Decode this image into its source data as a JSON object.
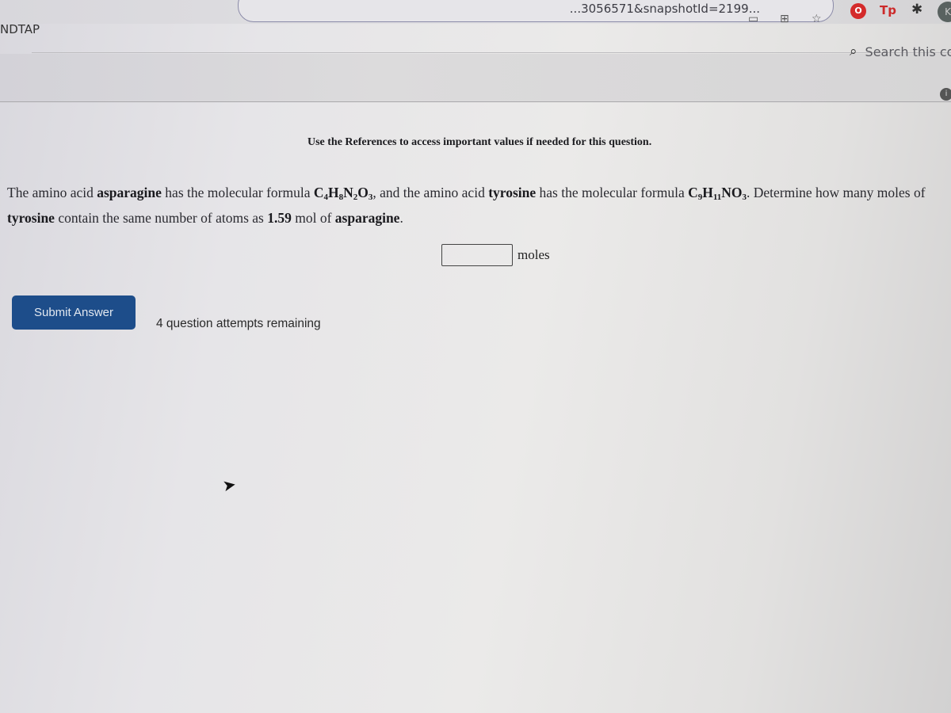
{
  "browser": {
    "url_text": "...3056571&snapshotId=2199...",
    "icons": [
      "cast-icon",
      "apps-icon",
      "bookmark-star-icon",
      "opera-extension-icon",
      "tp-extension-icon",
      "extensions-puzzle-icon",
      "profile-avatar"
    ],
    "profile_initial": "K",
    "tp_label": "Tp"
  },
  "tab": {
    "label": "NDTAP"
  },
  "header": {
    "search_placeholder": "Search this co"
  },
  "question": {
    "references_note": "Use the References to access important values if needed for this question.",
    "text_1": "The amino acid ",
    "compound_1": "asparagine",
    "text_2": " has the molecular formula ",
    "formula_1": {
      "C": "C",
      "c_sub": "4",
      "H": "H",
      "h_sub": "8",
      "N": "N",
      "n_sub": "2",
      "O": "O",
      "o_sub": "3"
    },
    "text_3": ", and the amino acid ",
    "compound_2": "tyrosine",
    "text_4": " has the molecular formula ",
    "formula_2": {
      "C": "C",
      "c_sub": "9",
      "H": "H",
      "h_sub": "11",
      "N": "NO",
      "o_sub": "3"
    },
    "text_5": ". Determine how many moles of ",
    "compound_3": "tyrosine",
    "text_6": " contain the same number of atoms as ",
    "amount": "1.59",
    "text_7": " mol of ",
    "compound_4": "asparagine",
    "text_8": "."
  },
  "answer": {
    "value": "",
    "unit": "moles"
  },
  "actions": {
    "submit_label": "Submit Answer",
    "attempts_text": "4 question attempts remaining"
  }
}
